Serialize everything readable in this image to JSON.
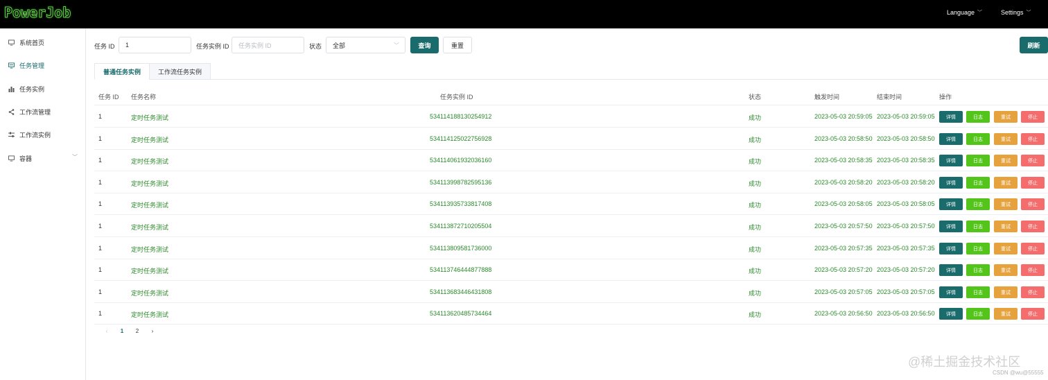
{
  "app": {
    "logo": "PowerJob"
  },
  "topbar": {
    "language": "Language",
    "settings": "Settings"
  },
  "sidebar": {
    "items": [
      {
        "label": "系统首页",
        "icon": "monitor-icon"
      },
      {
        "label": "任务管理",
        "icon": "task-icon",
        "active": true
      },
      {
        "label": "任务实例",
        "icon": "bar-chart-icon"
      },
      {
        "label": "工作流管理",
        "icon": "share-icon"
      },
      {
        "label": "工作流实例",
        "icon": "sliders-icon"
      },
      {
        "label": "容器",
        "icon": "container-icon"
      }
    ]
  },
  "filters": {
    "job_id_label": "任务 ID",
    "job_id_value": "1",
    "instance_id_label": "任务实例 ID",
    "instance_id_placeholder": "任务实例 ID",
    "status_label": "状态",
    "status_value": "全部",
    "query_button": "查询",
    "reset_button": "重置",
    "refresh_button": "刷新"
  },
  "tabs": [
    {
      "label": "普通任务实例",
      "active": true
    },
    {
      "label": "工作流任务实例",
      "active": false
    }
  ],
  "table": {
    "headers": [
      "任务 ID",
      "任务名称",
      "任务实例 ID",
      "状态",
      "触发时间",
      "结束时间",
      "操作"
    ],
    "action_labels": {
      "detail": "详情",
      "log": "日志",
      "retry": "重试",
      "stop": "停止"
    },
    "rows": [
      [
        "1",
        "定时任务测试",
        "534114188130254912",
        "成功",
        "2023-05-03 20:59:05",
        "2023-05-03 20:59:05"
      ],
      [
        "1",
        "定时任务测试",
        "534114125022756928",
        "成功",
        "2023-05-03 20:58:50",
        "2023-05-03 20:58:50"
      ],
      [
        "1",
        "定时任务测试",
        "534114061932036160",
        "成功",
        "2023-05-03 20:58:35",
        "2023-05-03 20:58:35"
      ],
      [
        "1",
        "定时任务测试",
        "534113998782595136",
        "成功",
        "2023-05-03 20:58:20",
        "2023-05-03 20:58:20"
      ],
      [
        "1",
        "定时任务测试",
        "534113935733817408",
        "成功",
        "2023-05-03 20:58:05",
        "2023-05-03 20:58:05"
      ],
      [
        "1",
        "定时任务测试",
        "534113872710205504",
        "成功",
        "2023-05-03 20:57:50",
        "2023-05-03 20:57:50"
      ],
      [
        "1",
        "定时任务测试",
        "534113809581736000",
        "成功",
        "2023-05-03 20:57:35",
        "2023-05-03 20:57:35"
      ],
      [
        "1",
        "定时任务测试",
        "534113746444877888",
        "成功",
        "2023-05-03 20:57:20",
        "2023-05-03 20:57:20"
      ],
      [
        "1",
        "定时任务测试",
        "534113683446431808",
        "成功",
        "2023-05-03 20:57:05",
        "2023-05-03 20:57:05"
      ],
      [
        "1",
        "定时任务测试",
        "534113620485734464",
        "成功",
        "2023-05-03 20:56:50",
        "2023-05-03 20:56:50"
      ]
    ]
  },
  "pagination": {
    "prev": "‹",
    "pages": [
      "1",
      "2"
    ],
    "current": "1",
    "next": "›"
  },
  "watermark": {
    "main": "@稀土掘金技术社区",
    "sub": "CSDN @wu@55555"
  },
  "colors": {
    "primary": "#1a6b6b",
    "success_text": "#2a8a2a",
    "log": "#52c41a",
    "retry": "#e6a23c",
    "stop": "#f56c6c"
  }
}
